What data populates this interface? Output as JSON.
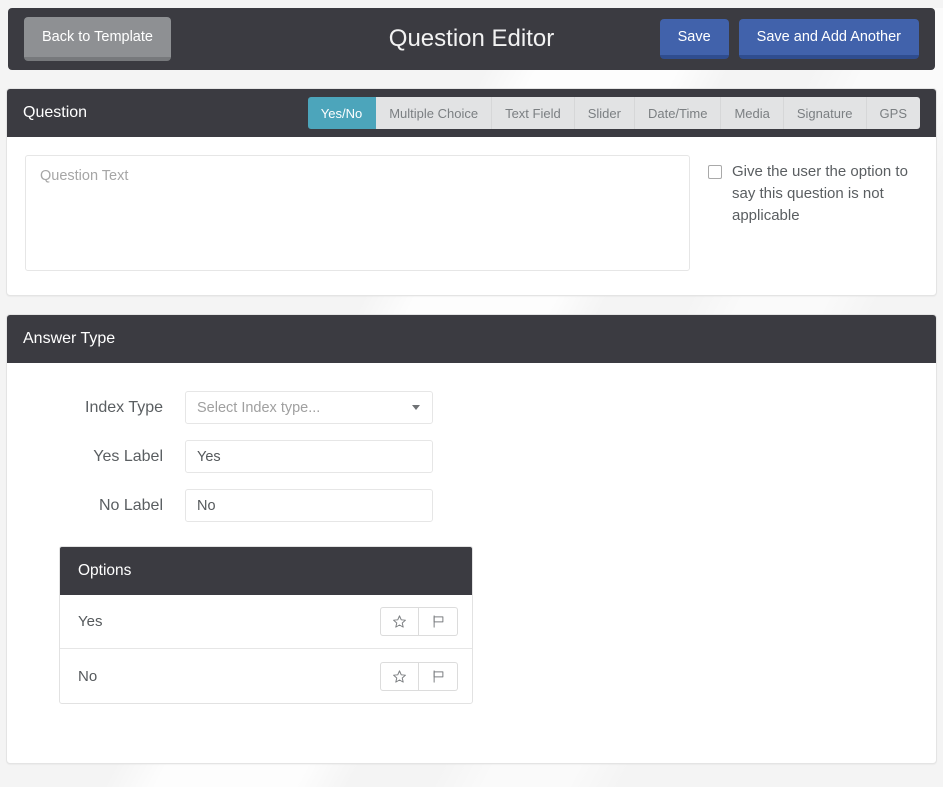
{
  "topbar": {
    "back_label": "Back to Template",
    "title": "Question Editor",
    "save_label": "Save",
    "save_add_label": "Save and Add Another"
  },
  "question_panel": {
    "title": "Question",
    "tabs": [
      {
        "label": "Yes/No",
        "active": true
      },
      {
        "label": "Multiple Choice",
        "active": false
      },
      {
        "label": "Text Field",
        "active": false
      },
      {
        "label": "Slider",
        "active": false
      },
      {
        "label": "Date/Time",
        "active": false
      },
      {
        "label": "Media",
        "active": false
      },
      {
        "label": "Signature",
        "active": false
      },
      {
        "label": "GPS",
        "active": false
      }
    ],
    "question_text_value": "",
    "question_text_placeholder": "Question Text",
    "na_option_label": "Give the user the option to say this question is not applicable",
    "na_option_checked": false
  },
  "answer_panel": {
    "title": "Answer Type",
    "fields": [
      {
        "label": "Index Type",
        "type": "select",
        "value": "Select Index type...",
        "placeholder": "Select Index type..."
      },
      {
        "label": "Yes Label",
        "type": "text",
        "value": "Yes",
        "placeholder": ""
      },
      {
        "label": "No Label",
        "type": "text",
        "value": "No",
        "placeholder": ""
      }
    ],
    "options": {
      "title": "Options",
      "rows": [
        {
          "label": "Yes",
          "star_icon": "star-outline-icon",
          "flag_icon": "flag-outline-icon"
        },
        {
          "label": "No",
          "star_icon": "star-outline-icon",
          "flag_icon": "flag-outline-icon"
        }
      ]
    }
  },
  "colors": {
    "header_dark": "#3b3b41",
    "accent_teal": "#4ca5bb",
    "primary_blue": "#4162ab",
    "back_gray": "#8e9093",
    "page_bg": "#f4f4f4"
  }
}
